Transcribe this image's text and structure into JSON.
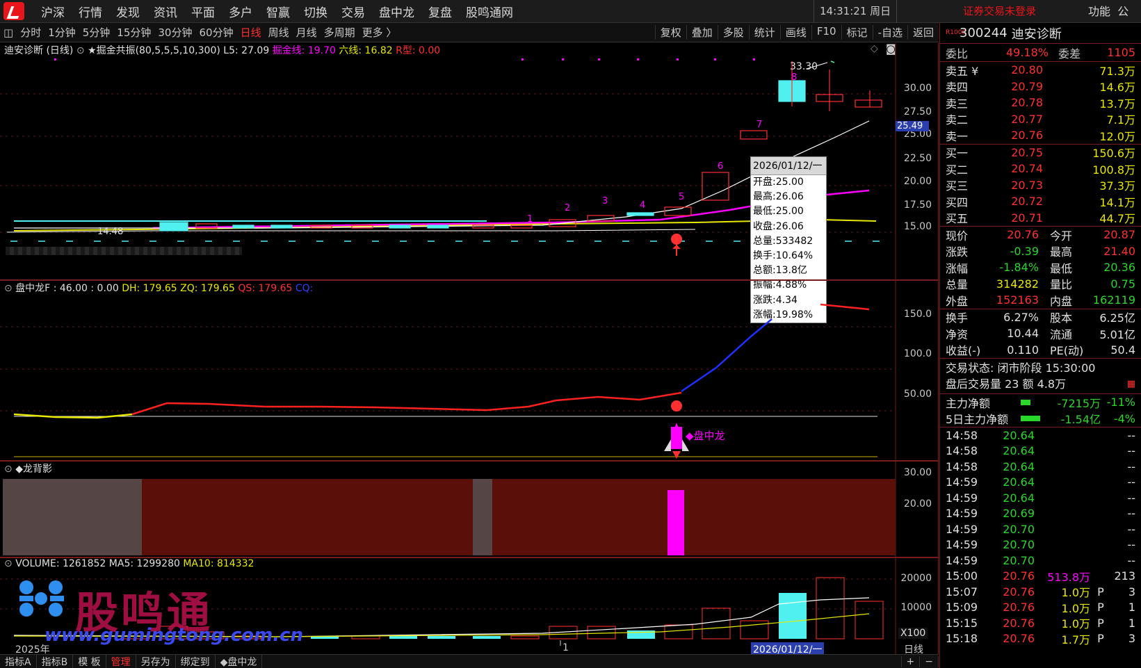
{
  "menubar": {
    "items": [
      "沪深",
      "行情",
      "发现",
      "资讯",
      "平面",
      "多户",
      "智赢",
      "切换",
      "交易",
      "盘中龙",
      "复盘",
      "股鸣通网"
    ],
    "clock": "14:31:21 周日",
    "login_status": "证券交易未登录",
    "func": "功能",
    "func_extra": "公"
  },
  "toolbar": {
    "periods": [
      "分时",
      "1分钟",
      "5分钟",
      "15分钟",
      "30分钟",
      "60分钟",
      "日线",
      "周线",
      "月线",
      "多周期",
      "更多 〉"
    ],
    "active_period": "日线",
    "right_tools": [
      "复权",
      "叠加",
      "多股",
      "统计",
      "画线",
      "F10",
      "标记",
      "-自选",
      "返回"
    ]
  },
  "main_chart": {
    "stock_title": "迪安诊断 (日线)",
    "indicator_name": "★掘金共振(80,5,5,5,10,300)",
    "l5_label": "L5: 27.09",
    "jj_label": "掘金线: 19.70",
    "liu_label": "六线: 16.82",
    "r_label": "R型: 0.00",
    "y_ticks": [
      "30.00",
      "27.50",
      "25.00",
      "22.50",
      "20.00",
      "17.50",
      "15.00"
    ],
    "high_label": "33.30",
    "low_label": "14.48",
    "current_price_tag": "25.49",
    "candle_numbers": [
      "1",
      "2",
      "3",
      "4",
      "5",
      "6",
      "7",
      "8"
    ],
    "accent_up": "#ff3030",
    "accent_down": "#50f0f0",
    "ma_magenta": "#ff00ff",
    "ma_yellow": "#e8e800"
  },
  "tooltip": {
    "date": "2026/01/12/一",
    "rows": [
      "开盘:25.00",
      "最高:26.06",
      "最低:25.00",
      "收盘:26.06",
      "总量:533482",
      "换手:10.64%",
      "总额:13.8亿",
      "振幅:4.88%",
      "涨跌:4.34",
      "涨幅:19.98%"
    ]
  },
  "panzhonglong": {
    "title_name": "盘中龙F : 46.00 : 0.00",
    "dh": "DH: 179.65",
    "zq": "ZQ: 179.65",
    "qs": "QS: 179.65",
    "cq": "CQ:",
    "y_ticks": [
      "150.0",
      "100.0",
      "50.00"
    ],
    "signal_label": "◆盘中龙"
  },
  "longbeiying": {
    "title": "◆龙背影",
    "y_ticks": [
      "30.00",
      "20.00"
    ]
  },
  "volume": {
    "title": "VOLUME: 1261852",
    "ma5": "MA5: 1299280",
    "ma10": "MA10: 814332",
    "y_ticks": [
      "20000",
      "10000"
    ],
    "multiplier": "X100",
    "axis_year": "2025年",
    "axis_mark": "1",
    "axis_date": "2026/01/12/一",
    "period_label": "日线",
    "watermark_cn": "股鸣通",
    "watermark_url": "www.gumingtong.com.cn"
  },
  "bottombar": {
    "tabs": [
      "指标A",
      "指标B",
      "模 板",
      "管理",
      "另存为",
      "绑定到",
      "◆盘中龙"
    ],
    "active_tab": "管理",
    "plus": "+",
    "minus": "−"
  },
  "side": {
    "code_badge": "R1000",
    "code": "300244",
    "name": "迪安诊断",
    "weibi_label": "委比",
    "weibi": "49.18%",
    "weicha_label": "委差",
    "weicha": "1105",
    "asks": [
      {
        "label": "卖五 ¥",
        "price": "20.80",
        "vol": "71.3万"
      },
      {
        "label": "卖四",
        "price": "20.79",
        "vol": "14.6万"
      },
      {
        "label": "卖三",
        "price": "20.78",
        "vol": "13.7万"
      },
      {
        "label": "卖二",
        "price": "20.77",
        "vol": "7.1万"
      },
      {
        "label": "卖一",
        "price": "20.76",
        "vol": "12.0万"
      }
    ],
    "bids": [
      {
        "label": "买一",
        "price": "20.75",
        "vol": "150.6万"
      },
      {
        "label": "买二",
        "price": "20.74",
        "vol": "100.8万"
      },
      {
        "label": "买三",
        "price": "20.73",
        "vol": "37.3万"
      },
      {
        "label": "买四",
        "price": "20.72",
        "vol": "14.1万"
      },
      {
        "label": "买五",
        "price": "20.71",
        "vol": "44.7万"
      }
    ],
    "stats": [
      {
        "l1": "现价",
        "v1": "20.76",
        "c1": "red",
        "l2": "今开",
        "v2": "20.87",
        "c2": "red"
      },
      {
        "l1": "涨跌",
        "v1": "-0.39",
        "c1": "green",
        "l2": "最高",
        "v2": "21.40",
        "c2": "red"
      },
      {
        "l1": "涨幅",
        "v1": "-1.84%",
        "c1": "green",
        "l2": "最低",
        "v2": "20.36",
        "c2": "green"
      },
      {
        "l1": "总量",
        "v1": "314282",
        "c1": "yel",
        "l2": "量比",
        "v2": "0.75",
        "c2": "green"
      },
      {
        "l1": "外盘",
        "v1": "152163",
        "c1": "red",
        "l2": "内盘",
        "v2": "162119",
        "c2": "green"
      }
    ],
    "stats2": [
      {
        "l1": "换手",
        "v1": "6.27%",
        "l2": "股本",
        "v2": "6.25亿"
      },
      {
        "l1": "净资",
        "v1": "10.44",
        "l2": "流通",
        "v2": "5.01亿"
      },
      {
        "l1": "收益(-)",
        "v1": "0.110",
        "l2": "PE(动)",
        "v2": "50.4"
      }
    ],
    "trade_status": "交易状态: 闭市阶段 15:30:00",
    "after_hours": "盘后交易量 23 额 4.8万",
    "main_net_label": "主力净额",
    "main_net_value": "-7215万",
    "main_net_pct": "-11%",
    "main_net5_label": "5日主力净额",
    "main_net5_value": "-1.54亿",
    "main_net5_pct": "-4%",
    "ticks": [
      {
        "t": "14:58",
        "p": "20.64",
        "v": "",
        "f": "",
        "n": "--"
      },
      {
        "t": "14:58",
        "p": "20.64",
        "v": "",
        "f": "",
        "n": "--"
      },
      {
        "t": "14:58",
        "p": "20.64",
        "v": "",
        "f": "",
        "n": "--"
      },
      {
        "t": "14:59",
        "p": "20.64",
        "v": "",
        "f": "",
        "n": "--"
      },
      {
        "t": "14:59",
        "p": "20.64",
        "v": "",
        "f": "",
        "n": "--"
      },
      {
        "t": "14:59",
        "p": "20.69",
        "v": "",
        "f": "",
        "n": "--"
      },
      {
        "t": "14:59",
        "p": "20.70",
        "v": "",
        "f": "",
        "n": "--"
      },
      {
        "t": "14:59",
        "p": "20.70",
        "v": "",
        "f": "",
        "n": "--"
      },
      {
        "t": "14:59",
        "p": "20.70",
        "v": "",
        "f": "",
        "n": "--"
      },
      {
        "t": "15:00",
        "p": "20.76",
        "v": "513.8万",
        "f": "",
        "n": "213"
      },
      {
        "t": "15:07",
        "p": "20.76",
        "v": "1.0万",
        "f": "P",
        "n": "3"
      },
      {
        "t": "15:09",
        "p": "20.76",
        "v": "1.0万",
        "f": "P",
        "n": "1"
      },
      {
        "t": "15:15",
        "p": "20.76",
        "v": "1.0万",
        "f": "P",
        "n": "1"
      },
      {
        "t": "15:18",
        "p": "20.76",
        "v": "1.7万",
        "f": "P",
        "n": "3"
      }
    ]
  }
}
